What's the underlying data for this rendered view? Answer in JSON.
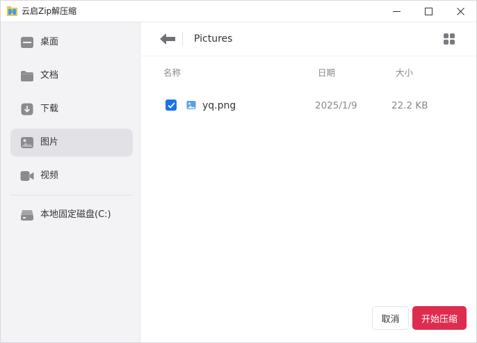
{
  "window": {
    "title": "云启Zip解压缩",
    "icon": "folder-zip-icon"
  },
  "sidebar": {
    "items": [
      {
        "label": "桌面",
        "icon": "desktop-icon",
        "active": false
      },
      {
        "label": "文档",
        "icon": "folder-icon",
        "active": false
      },
      {
        "label": "下载",
        "icon": "download-icon",
        "active": false
      },
      {
        "label": "图片",
        "icon": "image-icon",
        "active": true
      },
      {
        "label": "视频",
        "icon": "video-icon",
        "active": false
      },
      {
        "label": "本地固定磁盘(C:)",
        "icon": "drive-icon",
        "active": false
      }
    ]
  },
  "toolbar": {
    "path": "Pictures"
  },
  "table": {
    "headers": {
      "name": "名称",
      "date": "日期",
      "size": "大小"
    },
    "rows": [
      {
        "name": "yq.png",
        "date": "2025/1/9",
        "size": "22.2 KB",
        "checked": true
      }
    ]
  },
  "actions": {
    "cancel": "取消",
    "start": "开始压缩"
  },
  "colors": {
    "accent": "#de2c4f",
    "checkbox": "#1a73e8",
    "sidebar_bg": "#f3f3f5",
    "sidebar_active": "#e2e2e6"
  }
}
